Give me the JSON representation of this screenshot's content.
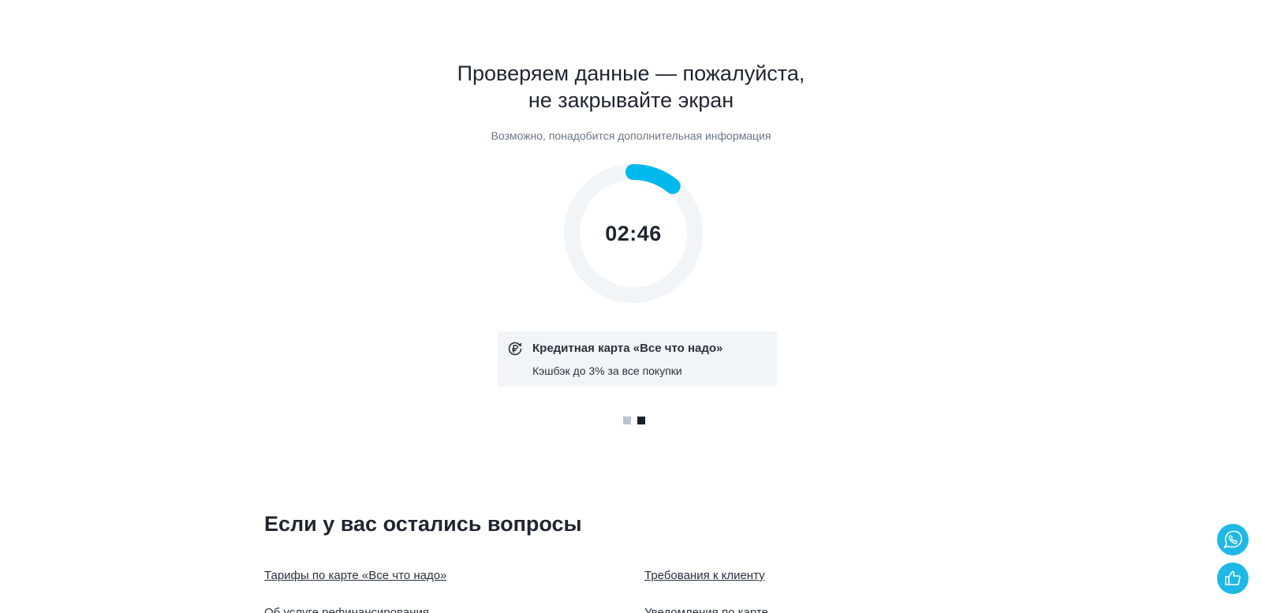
{
  "header": {
    "title_line1": "Проверяем данные — пожалуйста,",
    "title_line2": "не закрывайте экран",
    "subtitle": "Возможно, понадобится дополнительная информация"
  },
  "timer": {
    "time": "02:46",
    "progress": 0.11,
    "accent_color": "#00B8EB",
    "track_color": "#F2F5F8"
  },
  "promo": {
    "icon": "ruble-cashback-icon",
    "title": "Кредитная карта «Все что надо»",
    "description": "Кэшбэк до 3% за все покупки"
  },
  "carousel": {
    "count": 2,
    "active_index": 1
  },
  "faq": {
    "title": "Если у вас остались вопросы",
    "links": [
      "Тарифы по карте «Все что надо»",
      "Требования к клиенту",
      "Об услуге рефинансирования",
      "Уведомления по карте"
    ]
  },
  "floating": {
    "call_icon": "phone-chat-icon",
    "feedback_icon": "thumbs-up-icon",
    "color": "#1FB8E6"
  }
}
